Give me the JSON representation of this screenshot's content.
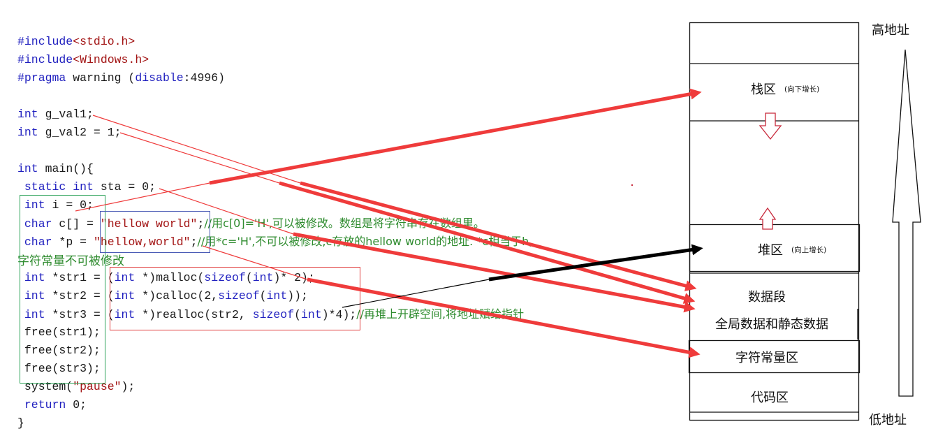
{
  "code": {
    "lines": [
      {
        "parts": [
          {
            "t": "#include",
            "c": "pp"
          },
          {
            "t": "<stdio.h>",
            "c": "str"
          }
        ]
      },
      {
        "parts": [
          {
            "t": "#include",
            "c": "pp"
          },
          {
            "t": "<Windows.h>",
            "c": "str"
          }
        ]
      },
      {
        "parts": [
          {
            "t": "#pragma",
            "c": "pp"
          },
          {
            "t": " warning (",
            "c": ""
          },
          {
            "t": "disable",
            "c": "kw"
          },
          {
            "t": ":4996)",
            "c": ""
          }
        ]
      },
      {
        "parts": []
      },
      {
        "parts": [
          {
            "t": "int",
            "c": "kw"
          },
          {
            "t": " g_val1;",
            "c": ""
          }
        ]
      },
      {
        "parts": [
          {
            "t": "int",
            "c": "kw"
          },
          {
            "t": " g_val2 = 1;",
            "c": ""
          }
        ]
      },
      {
        "parts": []
      },
      {
        "parts": [
          {
            "t": "int",
            "c": "kw"
          },
          {
            "t": " main(){",
            "c": ""
          }
        ]
      },
      {
        "parts": [
          {
            "t": " static int",
            "c": "kw"
          },
          {
            "t": " sta = 0;",
            "c": ""
          }
        ]
      },
      {
        "parts": [
          {
            "t": " int",
            "c": "kw"
          },
          {
            "t": " i = 0;",
            "c": ""
          }
        ]
      },
      {
        "parts": [
          {
            "t": " char",
            "c": "kw"
          },
          {
            "t": " c[] = ",
            "c": ""
          },
          {
            "t": "\"hellow world\"",
            "c": "str"
          },
          {
            "t": ";",
            "c": ""
          },
          {
            "t": "//用c[0]='H',可以被修改。数组是将字符串存在数组里。",
            "c": "cm"
          }
        ]
      },
      {
        "parts": [
          {
            "t": " char",
            "c": "kw"
          },
          {
            "t": " *p = ",
            "c": ""
          },
          {
            "t": "\"hellow,world\"",
            "c": "str"
          },
          {
            "t": ";",
            "c": ""
          },
          {
            "t": "//用*c='H',不可以被修改,c存放的hellow world的地址. *c相当于h,",
            "c": "cm"
          }
        ]
      },
      {
        "parts": []
      },
      {
        "parts": [
          {
            "t": " int",
            "c": "kw"
          },
          {
            "t": " *str1 = (",
            "c": ""
          },
          {
            "t": "int",
            "c": "kw"
          },
          {
            "t": " *)malloc(",
            "c": ""
          },
          {
            "t": "sizeof",
            "c": "kw"
          },
          {
            "t": "(",
            "c": ""
          },
          {
            "t": "int",
            "c": "kw"
          },
          {
            "t": ")* 2);",
            "c": ""
          }
        ]
      },
      {
        "parts": [
          {
            "t": " int",
            "c": "kw"
          },
          {
            "t": " *str2 = (",
            "c": ""
          },
          {
            "t": "int",
            "c": "kw"
          },
          {
            "t": " *)calloc(2,",
            "c": ""
          },
          {
            "t": "sizeof",
            "c": "kw"
          },
          {
            "t": "(",
            "c": ""
          },
          {
            "t": "int",
            "c": "kw"
          },
          {
            "t": "));",
            "c": ""
          }
        ]
      },
      {
        "parts": [
          {
            "t": " int",
            "c": "kw"
          },
          {
            "t": " *str3 = (",
            "c": ""
          },
          {
            "t": "int",
            "c": "kw"
          },
          {
            "t": " *)realloc(str2, ",
            "c": ""
          },
          {
            "t": "sizeof",
            "c": "kw"
          },
          {
            "t": "(",
            "c": ""
          },
          {
            "t": "int",
            "c": "kw"
          },
          {
            "t": ")*4);",
            "c": ""
          },
          {
            "t": "//再堆上开辟空间,将地址赋给指针",
            "c": "cm"
          }
        ]
      },
      {
        "parts": [
          {
            "t": " free(str1);",
            "c": ""
          }
        ]
      },
      {
        "parts": [
          {
            "t": " free(str2);",
            "c": ""
          }
        ]
      },
      {
        "parts": [
          {
            "t": " free(str3);",
            "c": ""
          }
        ]
      },
      {
        "parts": [
          {
            "t": " system(",
            "c": ""
          },
          {
            "t": "\"pause\"",
            "c": "str"
          },
          {
            "t": ");",
            "c": ""
          }
        ]
      },
      {
        "parts": [
          {
            "t": " return",
            "c": "kw"
          },
          {
            "t": " 0;",
            "c": ""
          }
        ]
      },
      {
        "parts": [
          {
            "t": "}",
            "c": ""
          }
        ]
      }
    ],
    "wrapped_comment": "字符常量不可被修改"
  },
  "memory": {
    "stack": {
      "label": "栈区",
      "note": "(向下增长)"
    },
    "heap": {
      "label": "堆区",
      "note": "(向上增长)"
    },
    "data_segment": {
      "label": "数据段",
      "sublabel": "全局数据和静态数据"
    },
    "string_constants": {
      "label": "字符常量区"
    },
    "code_segment": {
      "label": "代码区"
    }
  },
  "address": {
    "high": "高地址",
    "low": "低地址"
  },
  "colors": {
    "arrow_red": "#ef3b3b",
    "arrow_black": "#000000",
    "box_green": "#2fa35a",
    "box_blue": "#4a5bb5",
    "box_red": "#e03c3c"
  }
}
